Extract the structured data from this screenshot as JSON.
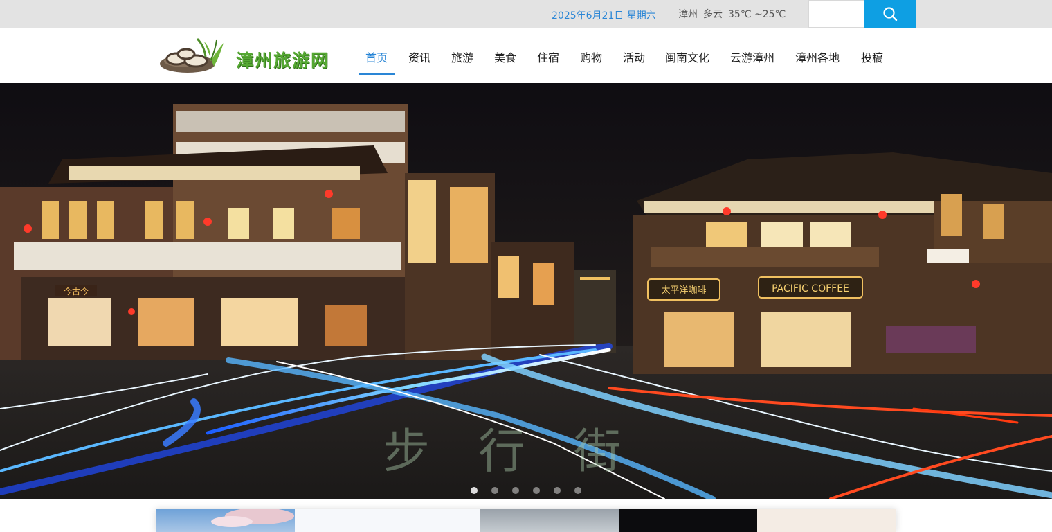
{
  "topbar": {
    "date": "2025年6月21日 星期六",
    "weather": {
      "city": "漳州",
      "condition": "多云",
      "temperature": "35℃ ~25℃"
    },
    "search": {
      "placeholder": "",
      "value": "",
      "button_icon": "search-icon"
    }
  },
  "header": {
    "logo_text": "漳州旅游网",
    "nav": [
      {
        "label": "首页",
        "active": true
      },
      {
        "label": "资讯"
      },
      {
        "label": "旅游"
      },
      {
        "label": "美食"
      },
      {
        "label": "住宿"
      },
      {
        "label": "购物"
      },
      {
        "label": "活动"
      },
      {
        "label": "闽南文化"
      },
      {
        "label": "云游漳州"
      },
      {
        "label": "漳州各地"
      },
      {
        "label": "投稿"
      }
    ]
  },
  "banner": {
    "signs": {
      "left_shop": "今古今",
      "right_shop": "太平洋咖啡",
      "coffee": "PACIFIC COFFEE",
      "road_text": "步行街"
    },
    "slide_count": 6,
    "active_slide": 1
  },
  "colors": {
    "accent": "#2a86d6",
    "search_button": "#0e9fe3",
    "topbar_bg": "#e3e3e3",
    "logo_green": "#55a832"
  }
}
